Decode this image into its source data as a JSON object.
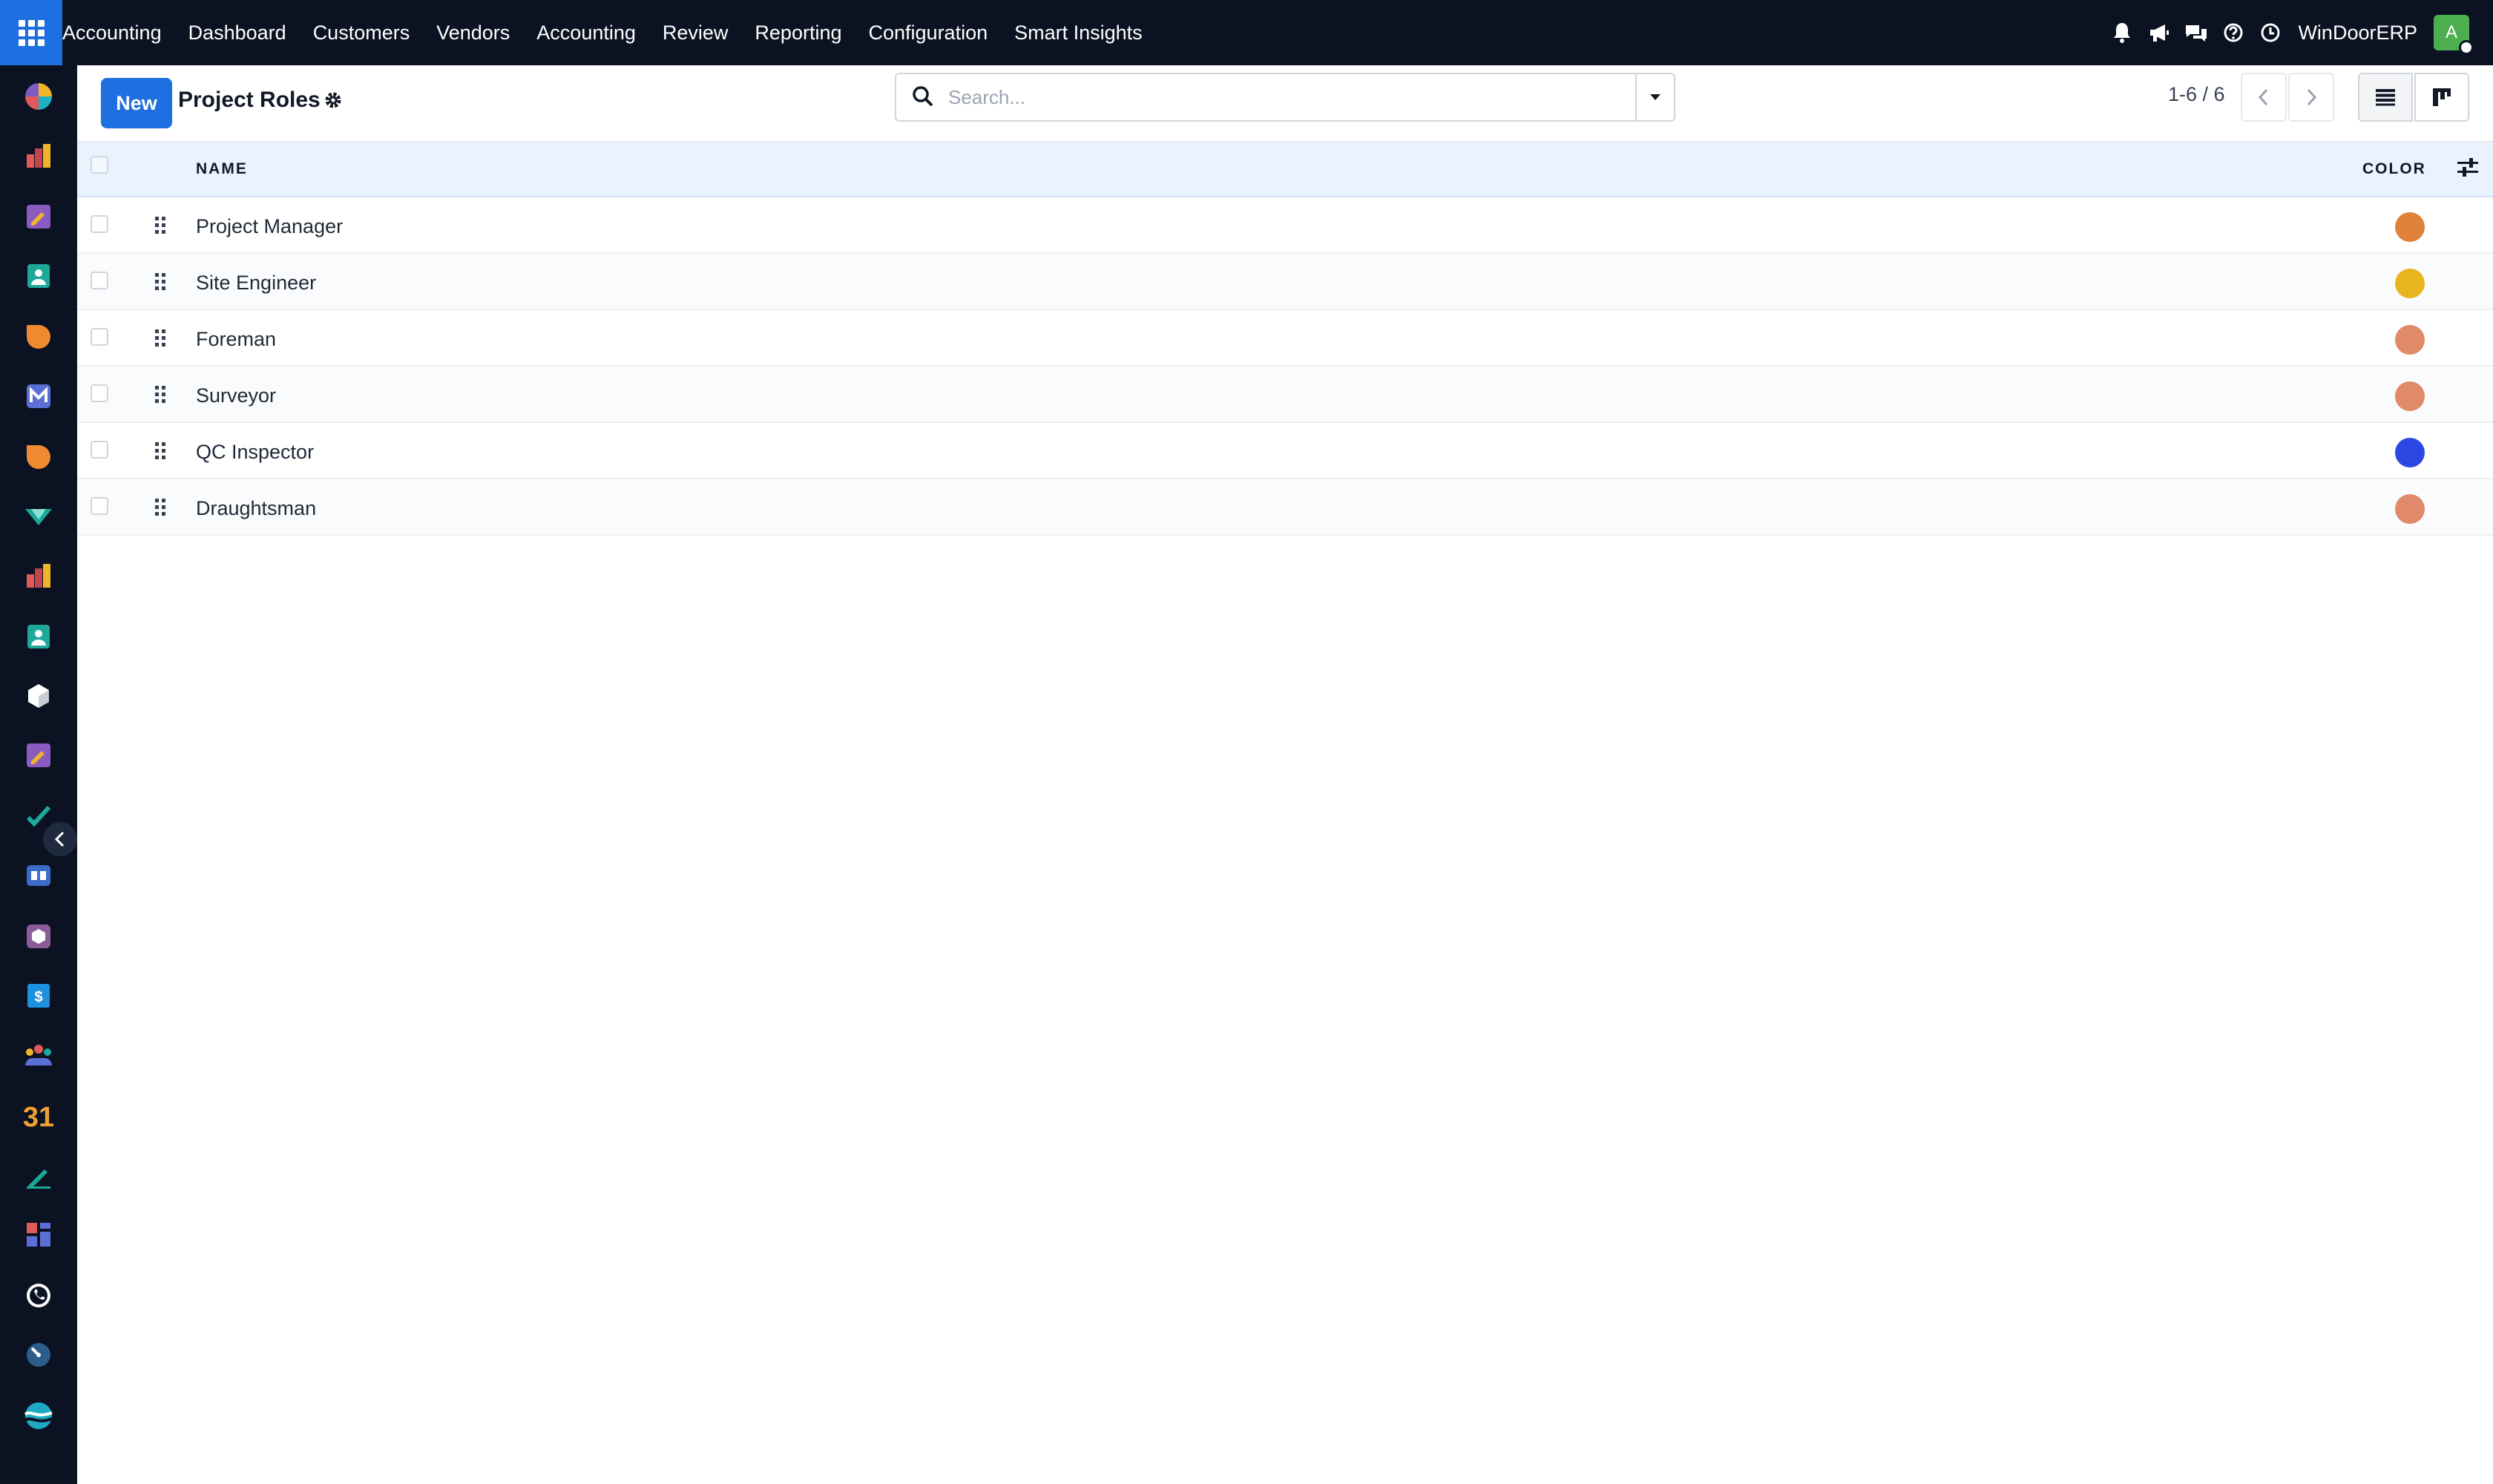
{
  "topbar": {
    "brand": "Accounting",
    "nav": [
      "Dashboard",
      "Customers",
      "Vendors",
      "Accounting",
      "Review",
      "Reporting",
      "Configuration",
      "Smart Insights"
    ],
    "icons": [
      "bell-icon",
      "megaphone-icon",
      "chat-icon",
      "help-icon",
      "clock-icon"
    ],
    "company": "WinDoorERP",
    "avatar_letter": "A"
  },
  "sidebar": {
    "apps": [
      "discuss-icon",
      "reports-icon",
      "sign-icon",
      "contacts-icon",
      "crm-icon",
      "mail-icon",
      "livechat-icon",
      "project-icon",
      "sales-icon",
      "employees-icon",
      "inventory-icon",
      "sign-2-icon",
      "tasks-icon",
      "knowledge-icon",
      "barcode-icon",
      "invoicing-icon",
      "team-icon",
      "calendar-icon",
      "notes-icon",
      "dashboard-icon",
      "whatsapp-icon",
      "timesheet-icon",
      "website-icon"
    ],
    "calendar_day": "31"
  },
  "control": {
    "new_label": "New",
    "title": "Project Roles",
    "search_placeholder": "Search...",
    "pager": "1-6 / 6"
  },
  "table": {
    "headers": {
      "name": "NAME",
      "color": "COLOR"
    },
    "rows": [
      {
        "name": "Project Manager",
        "color": "#e0823a"
      },
      {
        "name": "Site Engineer",
        "color": "#e8b51e"
      },
      {
        "name": "Foreman",
        "color": "#e08a6a"
      },
      {
        "name": "Surveyor",
        "color": "#e08a6a"
      },
      {
        "name": "QC Inspector",
        "color": "#2c47e2"
      },
      {
        "name": "Draughtsman",
        "color": "#e08a6a"
      }
    ]
  }
}
